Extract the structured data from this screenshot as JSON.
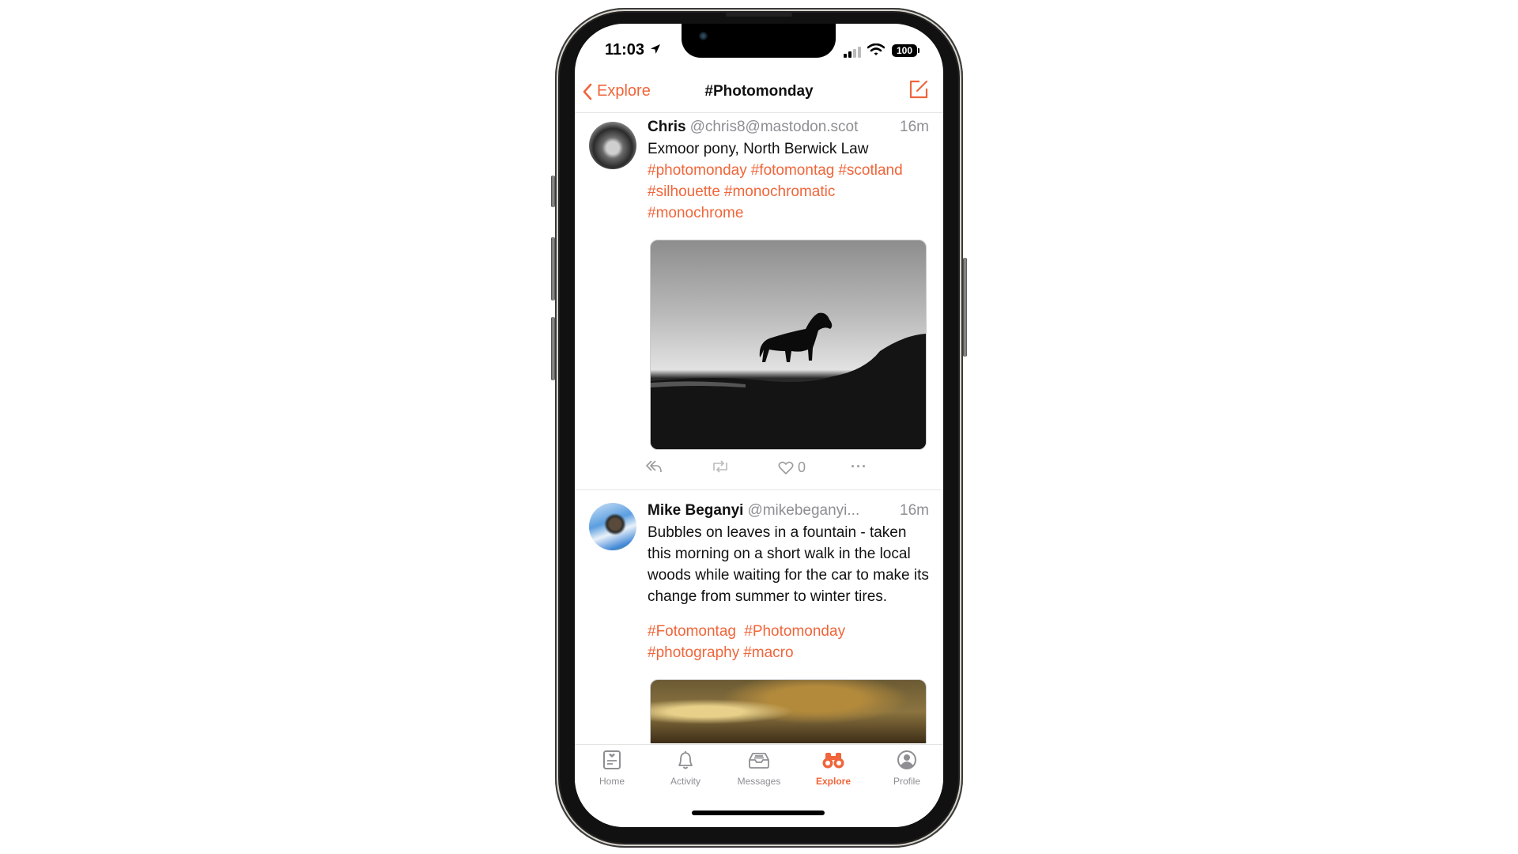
{
  "status_bar": {
    "time": "11:03",
    "battery": "100",
    "signal_bars_filled": 2,
    "signal_bars_total": 4
  },
  "nav": {
    "back_label": "Explore",
    "title": "#Photomonday"
  },
  "colors": {
    "accent": "#f0653a",
    "secondary_text": "#8e8e93"
  },
  "posts": [
    {
      "name": "Chris",
      "handle": "@chris8@mastodon.scot",
      "time": "16m",
      "text": "Exmoor pony, North Berwick Law",
      "tags": [
        "#photomonday",
        "#fotomontag",
        "#scotland",
        "#silhouette",
        "#monochromatic",
        "#monochrome"
      ],
      "media_alt": "Black and white silhouette of a pony on a hill",
      "likes": "0"
    },
    {
      "name": "Mike Beganyi",
      "handle": "@mikebeganyi...",
      "time": "16m",
      "text": "Bubbles on leaves in a fountain - taken this morning on a short walk in the local woods while waiting for the car to make its change from summer to winter tires.",
      "tags": [
        "#Fotomontag",
        "#Photomonday",
        "#photography",
        "#macro"
      ],
      "media_alt": "Macro photo of bubbles on leaves"
    }
  ],
  "tabs": [
    {
      "label": "Home",
      "icon": "home-icon"
    },
    {
      "label": "Activity",
      "icon": "bell-icon"
    },
    {
      "label": "Messages",
      "icon": "inbox-icon"
    },
    {
      "label": "Explore",
      "icon": "binoculars-icon",
      "active": true
    },
    {
      "label": "Profile",
      "icon": "person-circle-icon"
    }
  ]
}
